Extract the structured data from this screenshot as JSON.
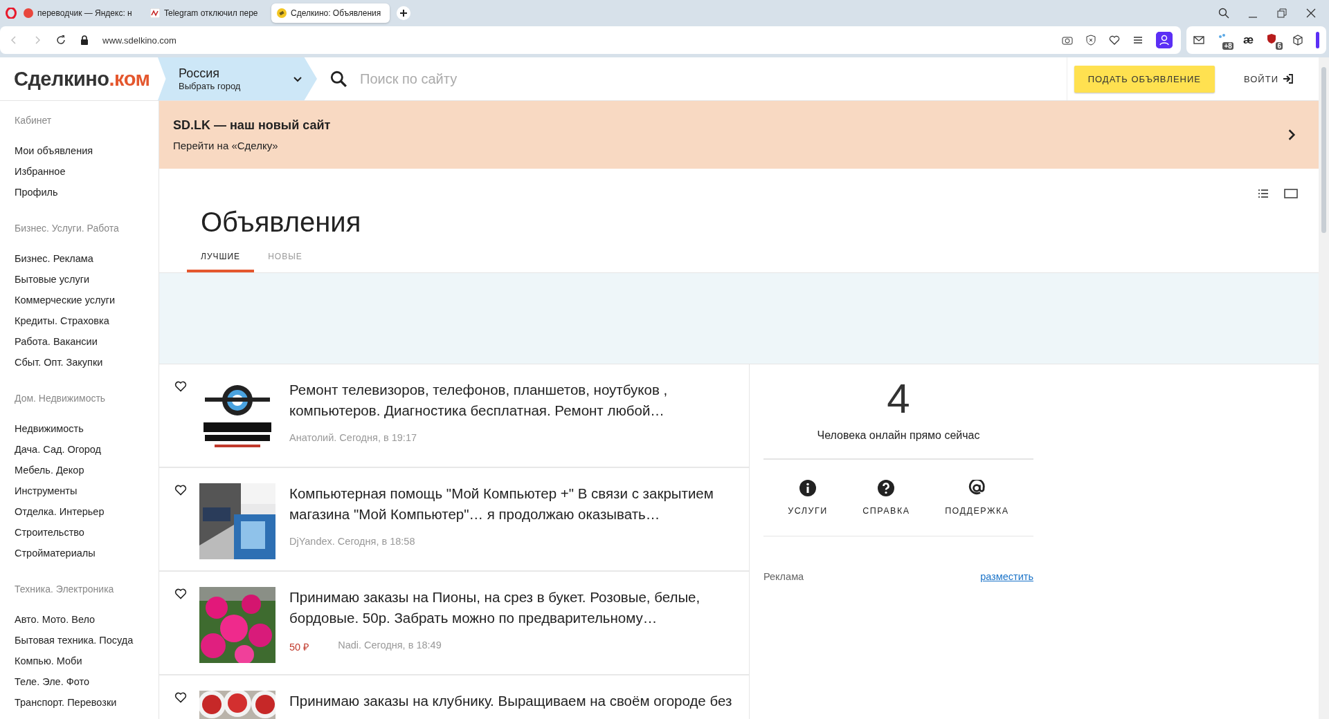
{
  "browser": {
    "tabs": [
      {
        "title": "переводчик — Яндекс: н",
        "selected": false
      },
      {
        "title": "Telegram отключил пере",
        "selected": false
      },
      {
        "title": "Сделкино: Объявления",
        "selected": true
      }
    ],
    "url": "www.sdelkino.com",
    "extension_glyph": "æ",
    "badges": [
      "+8",
      "6"
    ]
  },
  "header": {
    "logo_main": "Сделкино",
    "logo_accent": ".ком",
    "region": "Россия",
    "region_hint": "Выбрать город",
    "search_placeholder": "Поиск по сайту",
    "post_button": "ПОДАТЬ ОБЪЯВЛЕНИЕ",
    "login": "ВОЙТИ"
  },
  "sidebar": {
    "sections": [
      {
        "heading": "Кабинет",
        "items": [
          "Мои объявления",
          "Избранное",
          "Профиль"
        ]
      },
      {
        "heading": "Бизнес. Услуги. Работа",
        "items": [
          "Бизнес. Реклама",
          "Бытовые услуги",
          "Коммерческие услуги",
          "Кредиты. Страховка",
          "Работа. Вакансии",
          "Сбыт. Опт. Закупки"
        ]
      },
      {
        "heading": "Дом. Недвижимость",
        "items": [
          "Недвижимость",
          "Дача. Сад. Огород",
          "Мебель. Декор",
          "Инструменты",
          "Отделка. Интерьер",
          "Строительство",
          "Стройматериалы"
        ]
      },
      {
        "heading": "Техника. Электроника",
        "items": [
          "Авто. Мото. Вело",
          "Бытовая техника. Посуда",
          "Компью. Моби",
          "Теле. Эле. Фото",
          "Транспорт. Перевозки"
        ]
      }
    ]
  },
  "banner": {
    "title": "SD.LK — наш новый сайт",
    "subtitle": "Перейти на «Сделку»"
  },
  "page_title": "Объявления",
  "tabs": [
    {
      "label": "ЛУЧШИЕ",
      "selected": true
    },
    {
      "label": "НОВЫЕ",
      "selected": false
    }
  ],
  "listings": [
    {
      "title": "Ремонт телевизоров, телефонов, планшетов, ноутбуков , компьютеров. Диагностика бесплатная. Ремонт любой…",
      "meta": "Анатолий. Сегодня, в 19:17"
    },
    {
      "title": "Компьютерная помощь \"Мой Компьютер +\" В связи с закрытием магазина \"Мой Компьютер\"… я продолжаю оказывать…",
      "meta": "DjYandex. Сегодня, в 18:58"
    },
    {
      "title": "Принимаю заказы на Пионы, на срез в букет. Розовые, белые, бордовые. 50р. Забрать можно по предварительному…",
      "price": "50 ₽",
      "meta": "Nadi. Сегодня, в 18:49"
    },
    {
      "title": "Принимаю заказы на клубнику. Выращиваем на своём огороде без"
    }
  ],
  "online": {
    "count": "4",
    "caption": "Человека онлайн прямо сейчас"
  },
  "links": [
    {
      "label": "УСЛУГИ",
      "kind": "info"
    },
    {
      "label": "СПРАВКА",
      "kind": "help"
    },
    {
      "label": "ПОДДЕРЖКА",
      "kind": "at"
    }
  ],
  "ads": {
    "label": "Реклама",
    "link": "разместить"
  }
}
